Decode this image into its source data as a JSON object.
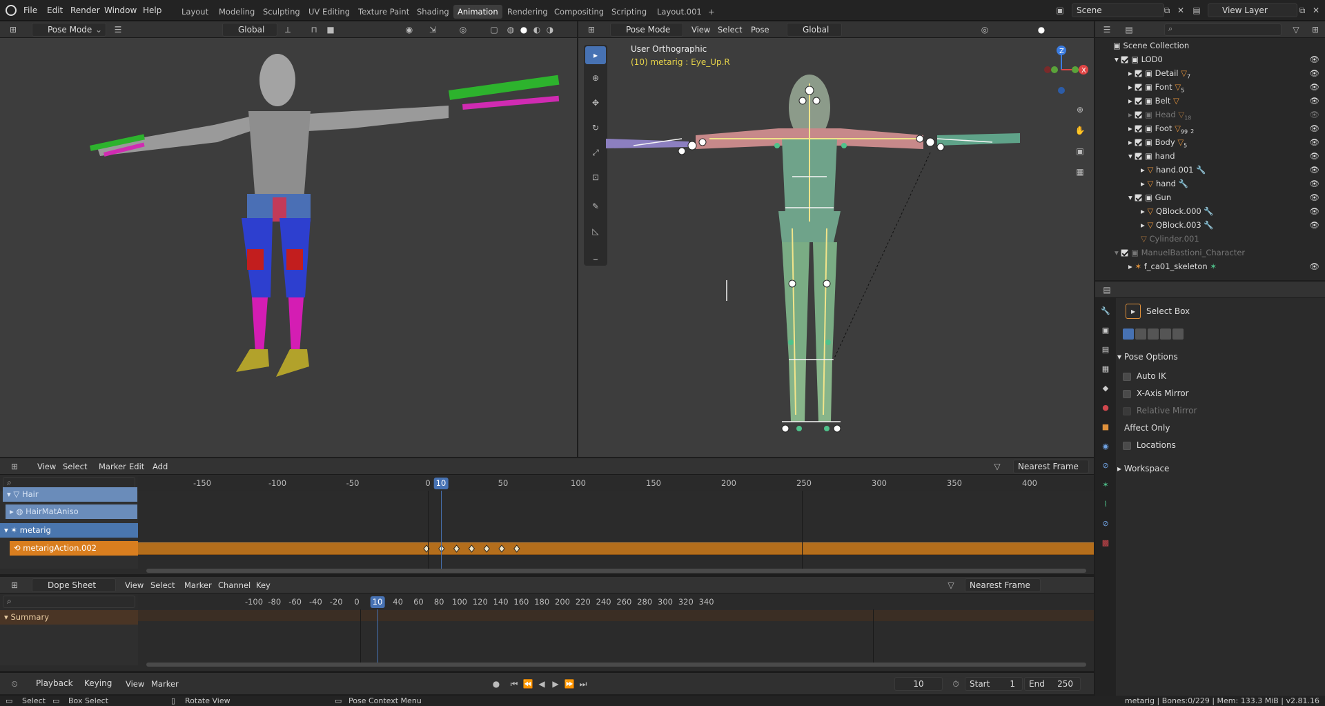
{
  "topbar": {
    "menus": [
      "File",
      "Edit",
      "Render",
      "Window",
      "Help"
    ],
    "workspaces": [
      "Layout",
      "Modeling",
      "Sculpting",
      "UV Editing",
      "Texture Paint",
      "Shading",
      "Animation",
      "Rendering",
      "Compositing",
      "Scripting",
      "Layout.001"
    ],
    "active_workspace": "Animation",
    "scene": "Scene",
    "view_layer": "View Layer"
  },
  "left_viewport": {
    "mode": "Pose Mode",
    "orientation": "Global"
  },
  "right_viewport": {
    "mode": "Pose Mode",
    "menus": [
      "View",
      "Select",
      "Pose"
    ],
    "orientation": "Global",
    "view_name": "User Orthographic",
    "active_info": "(10) metarig : Eye_Up.R"
  },
  "outliner": {
    "search_placeholder": "",
    "rows": [
      {
        "label": "Scene Collection",
        "indent": 0
      },
      {
        "label": "LOD0",
        "indent": 1
      },
      {
        "label": "Detail",
        "indent": 2
      },
      {
        "label": "Font",
        "indent": 2
      },
      {
        "label": "Belt",
        "indent": 2
      },
      {
        "label": "Head",
        "indent": 2
      },
      {
        "label": "Foot",
        "indent": 2
      },
      {
        "label": "Body",
        "indent": 2
      },
      {
        "label": "hand",
        "indent": 2
      },
      {
        "label": "hand.001",
        "indent": 3
      },
      {
        "label": "hand",
        "indent": 3
      },
      {
        "label": "Gun",
        "indent": 2
      },
      {
        "label": "QBlock.000",
        "indent": 3
      },
      {
        "label": "QBlock.003",
        "indent": 3
      },
      {
        "label": "Cylinder.001",
        "indent": 2
      },
      {
        "label": "ManuelBastioni_Character",
        "indent": 1
      },
      {
        "label": "f_ca01_skeleton",
        "indent": 2
      }
    ],
    "badges": {
      "detail": "7",
      "font": "5",
      "head": "18",
      "foot_a": "99",
      "foot_b": "2",
      "body": "5"
    }
  },
  "properties": {
    "tool_name": "Select Box",
    "pose_options_title": "Pose Options",
    "auto_ik": "Auto IK",
    "x_axis_mirror": "X-Axis Mirror",
    "relative_mirror": "Relative Mirror",
    "affect_only": "Affect Only",
    "locations": "Locations",
    "workspace": "Workspace"
  },
  "nla": {
    "menus": [
      "View",
      "Select",
      "Marker",
      "Edit",
      "Add"
    ],
    "snap": "Nearest Frame",
    "ruler_ticks": [
      "-150",
      "-100",
      "-50",
      "0",
      "50",
      "100",
      "150",
      "200",
      "250",
      "300",
      "350",
      "400"
    ],
    "current_frame": "10",
    "channels": [
      "Hair",
      "HairMatAniso",
      "metarig",
      "metarigAction.002"
    ],
    "keyframes": [
      0,
      10,
      20,
      30,
      40,
      50,
      60
    ]
  },
  "dopesheet": {
    "editor_type": "Dope Sheet",
    "menus": [
      "View",
      "Select",
      "Marker",
      "Channel",
      "Key"
    ],
    "snap": "Nearest Frame",
    "ruler_ticks": [
      "-100",
      "-80",
      "-60",
      "-40",
      "-20",
      "0",
      "20",
      "40",
      "60",
      "80",
      "100",
      "120",
      "140",
      "160",
      "180",
      "200",
      "220",
      "240",
      "260",
      "280",
      "300",
      "320",
      "340"
    ],
    "current_frame": "10",
    "summary": "Summary"
  },
  "timeline": {
    "menus": [
      "Playback",
      "Keying",
      "View",
      "Marker"
    ],
    "current_frame": "10",
    "start_label": "Start",
    "start": "1",
    "end_label": "End",
    "end": "250"
  },
  "statusbar": {
    "select": "Select",
    "box_select": "Box Select",
    "rotate_view": "Rotate View",
    "context_menu": "Pose Context Menu",
    "info": "metarig | Bones:0/229 | Mem: 133.3 MiB | v2.81.16"
  }
}
